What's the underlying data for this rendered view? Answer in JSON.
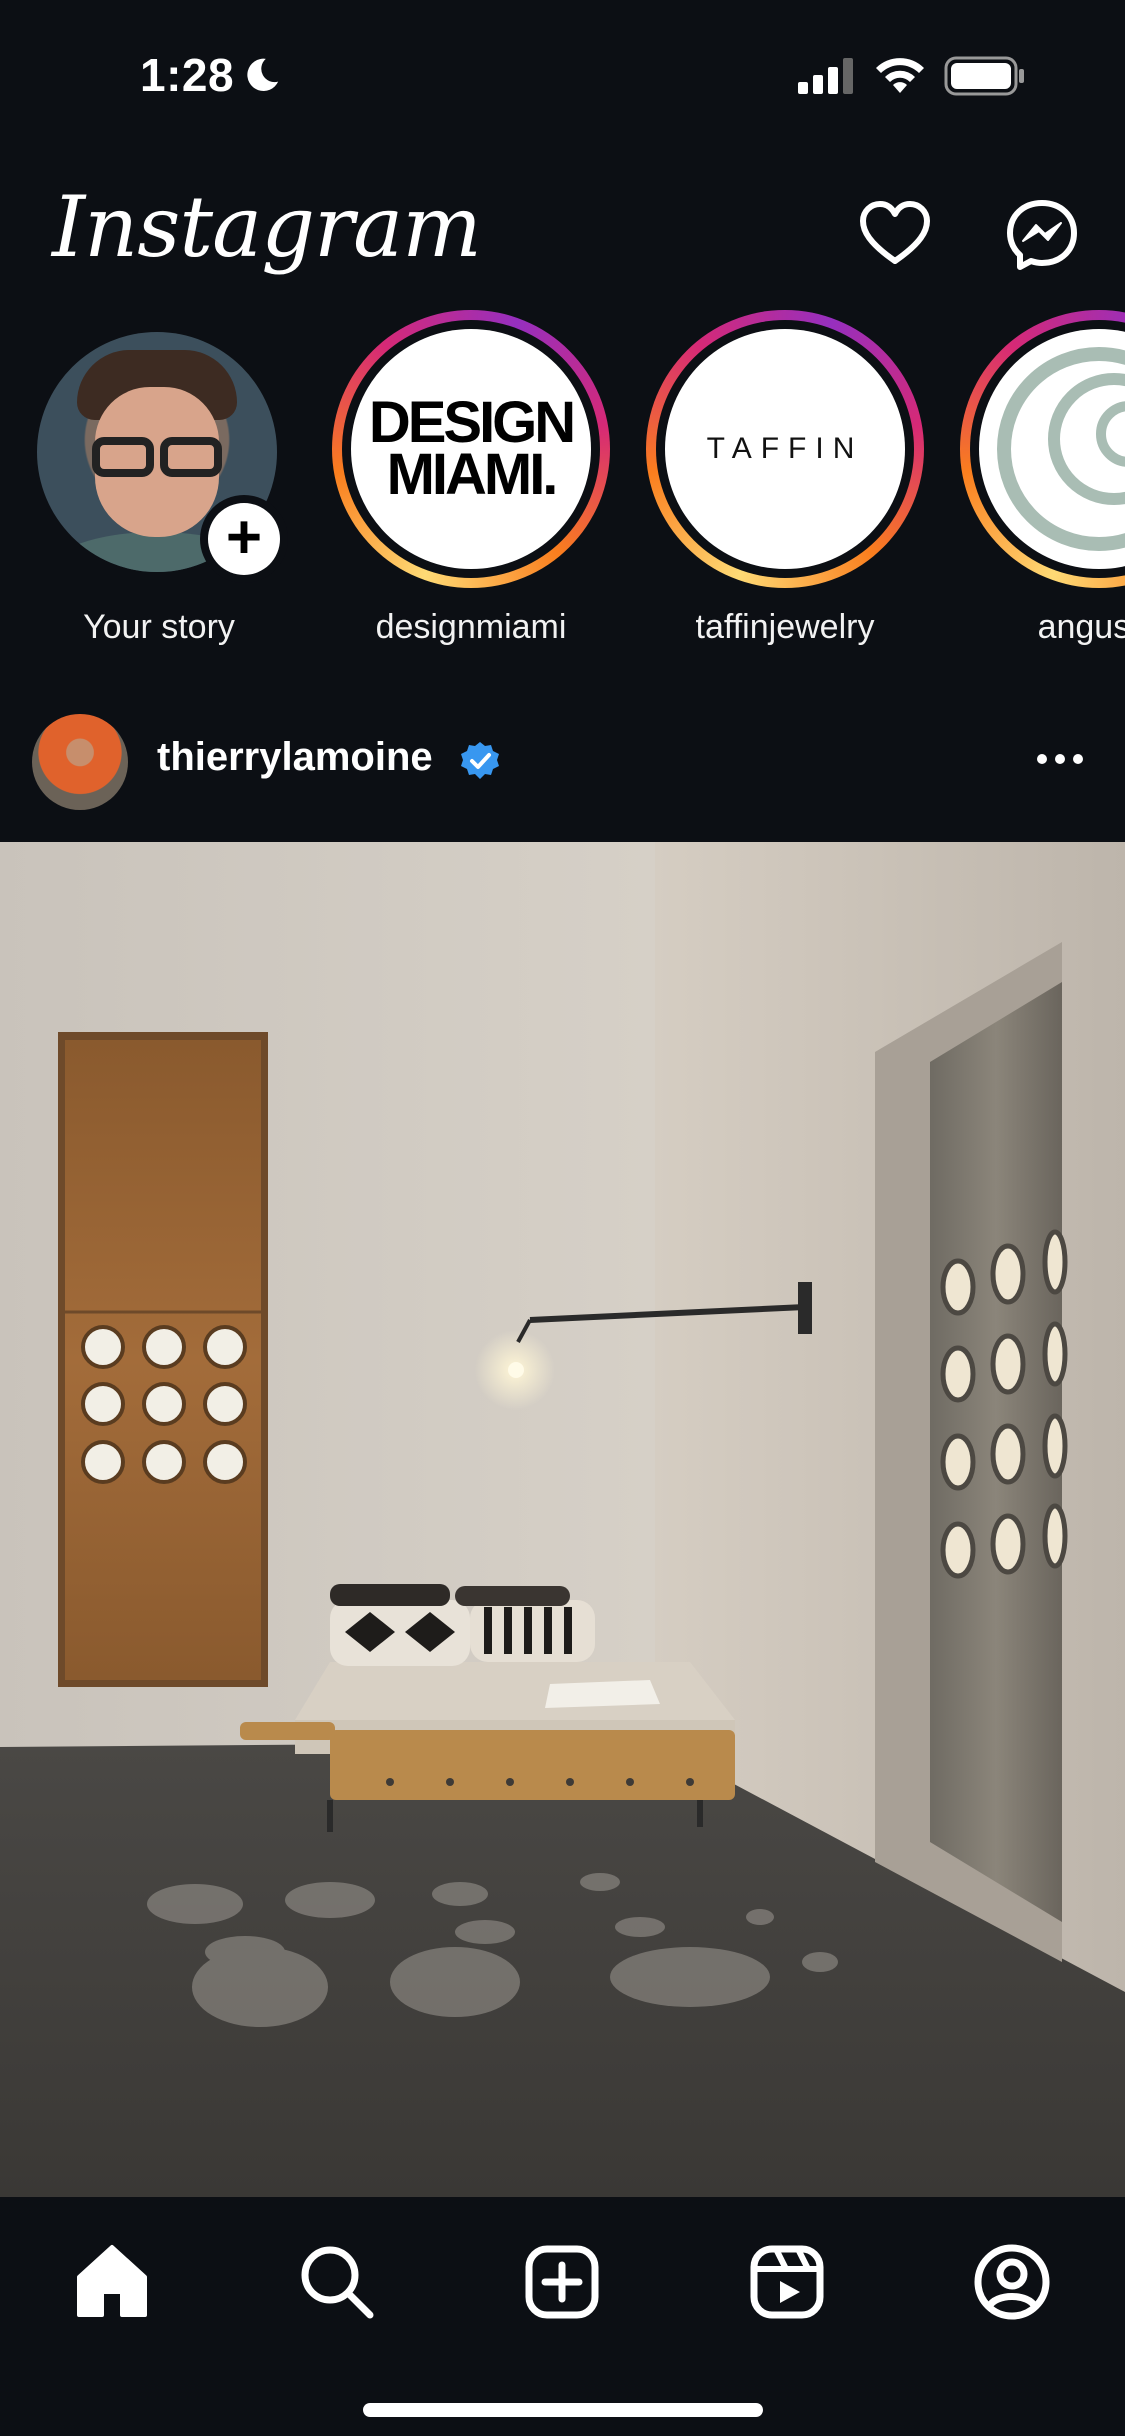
{
  "status_bar": {
    "time": "1:28",
    "icons": [
      "moon-icon",
      "cellular-signal-icon",
      "wifi-icon",
      "battery-icon"
    ]
  },
  "header": {
    "logo": "Instagram",
    "actions": [
      "heart-icon",
      "messenger-icon"
    ]
  },
  "stories": [
    {
      "username": "Your story",
      "own": true
    },
    {
      "username": "designmiami",
      "logo_text": "DESIGN MIAMI."
    },
    {
      "username": "taffinjewelry",
      "logo_text": "TAFFIN"
    },
    {
      "username": "angusro"
    }
  ],
  "post": {
    "username": "thierrylamoine",
    "verified": true,
    "more_icon": "more-horizontal-icon"
  },
  "bottom_nav": {
    "items": [
      "home-icon",
      "search-icon",
      "create-icon",
      "reels-icon",
      "profile-icon"
    ],
    "active": "home-icon"
  },
  "colors": {
    "background": "#0c0f14",
    "verified_blue": "#3897f0",
    "story_ring_gradient": [
      "#feda75",
      "#fa7e1e",
      "#d62976",
      "#962fbf"
    ]
  }
}
